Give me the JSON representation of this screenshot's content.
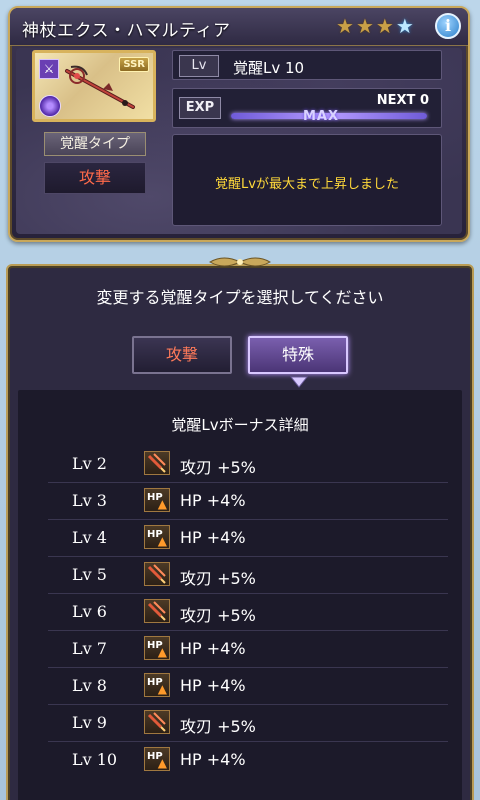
{
  "header": {
    "title": "神杖エクス・ハマルティア",
    "stars": [
      {
        "icon": "gold-star-icon"
      },
      {
        "icon": "gold-star-icon"
      },
      {
        "icon": "gold-star-icon"
      },
      {
        "icon": "blue-star-icon"
      }
    ],
    "info_icon": "info-icon"
  },
  "weapon": {
    "rarity": "SSR",
    "awakening_type_label": "覚醒タイプ",
    "awakening_type_value": "攻撃"
  },
  "level": {
    "tag": "Lv",
    "text": "覚醒Lv 10"
  },
  "exp": {
    "tag": "EXP",
    "next_label": "NEXT 0",
    "max_label": "MAX",
    "progress": 1.0
  },
  "message": {
    "text": "覚醒Lvが最大まで上昇しました"
  },
  "panel": {
    "title": "変更する覚醒タイプを選択してください",
    "choices": [
      {
        "label": "攻撃",
        "selected": false
      },
      {
        "label": "特殊",
        "selected": true
      }
    ]
  },
  "bonus": {
    "title": "覚醒Lvボーナス詳細",
    "rows": [
      {
        "lv": "Lv 2",
        "icon": "attack-blade-icon",
        "text": "攻刃 +5%"
      },
      {
        "lv": "Lv 3",
        "icon": "hp-up-icon",
        "text": "HP +4%"
      },
      {
        "lv": "Lv 4",
        "icon": "hp-up-icon",
        "text": "HP +4%"
      },
      {
        "lv": "Lv 5",
        "icon": "attack-blade-icon",
        "text": "攻刃 +5%"
      },
      {
        "lv": "Lv 6",
        "icon": "attack-blade-icon",
        "text": "攻刃 +5%"
      },
      {
        "lv": "Lv 7",
        "icon": "hp-up-icon",
        "text": "HP +4%"
      },
      {
        "lv": "Lv 8",
        "icon": "hp-up-icon",
        "text": "HP +4%"
      },
      {
        "lv": "Lv 9",
        "icon": "attack-blade-icon",
        "text": "攻刃 +5%"
      },
      {
        "lv": "Lv 10",
        "icon": "hp-up-icon",
        "text": "HP +4%"
      }
    ]
  },
  "colors": {
    "gold_frame": "#c9a85b",
    "attack_red": "#ff6a4a",
    "message_yellow": "#ffd93a",
    "selected_purple": "#7a5fae"
  }
}
